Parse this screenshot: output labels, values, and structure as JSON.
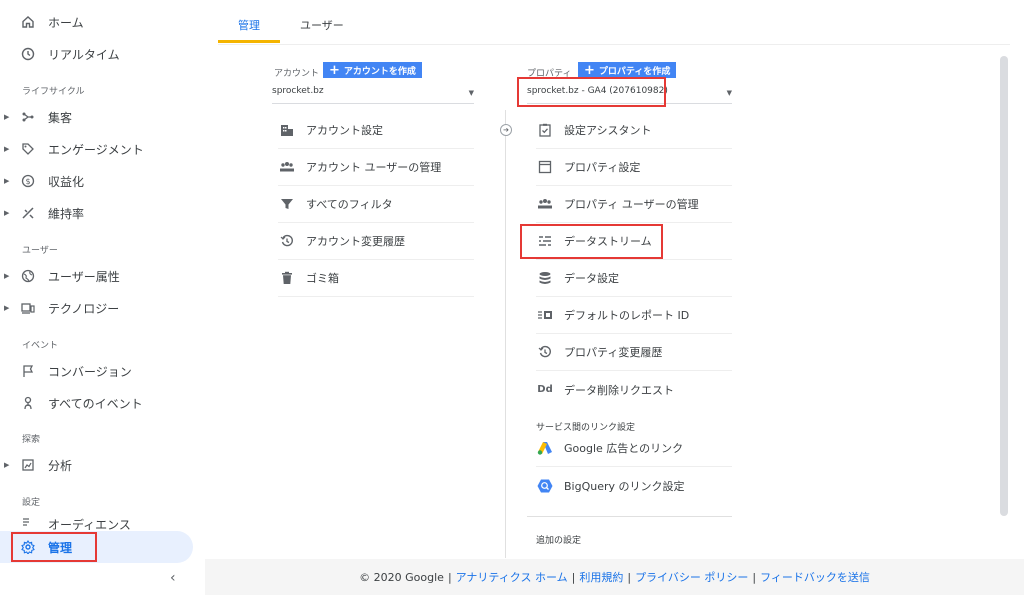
{
  "sidebar": {
    "nav": {
      "home": "ホーム",
      "realtime": "リアルタイム",
      "acquisition": "集客",
      "engagement": "エンゲージメント",
      "monetization": "収益化",
      "retention": "維持率",
      "demographics": "ユーザー属性",
      "tech": "テクノロジー",
      "conversions": "コンバージョン",
      "all_events": "すべてのイベント",
      "analysis": "分析",
      "audiences": "オーディエンス",
      "admin": "管理"
    },
    "sections": {
      "lifecycle": "ライフサイクル",
      "user": "ユーザー",
      "event": "イベント",
      "explore": "探索",
      "config": "設定"
    },
    "collapse": "‹"
  },
  "header": {
    "tabs": [
      "管理",
      "ユーザー"
    ]
  },
  "account": {
    "label": "アカウント",
    "create": "アカウントを作成",
    "selected": "sprocket.bz",
    "items": [
      "アカウント設定",
      "アカウント ユーザーの管理",
      "すべてのフィルタ",
      "アカウント変更履歴",
      "ゴミ箱"
    ]
  },
  "property": {
    "label": "プロパティ",
    "create": "プロパティを作成",
    "selected": "sprocket.bz - GA4 (207610982)",
    "items": [
      "設定アシスタント",
      "プロパティ設定",
      "プロパティ ユーザーの管理",
      "データストリーム",
      "データ設定",
      "デフォルトのレポート ID",
      "プロパティ変更履歴",
      "データ削除リクエスト"
    ],
    "links_heading": "サービス間のリンク設定",
    "links": [
      "Google 広告とのリンク",
      "BigQuery のリンク設定"
    ],
    "extra_heading": "追加の設定"
  },
  "footer": {
    "copyright": "© 2020 Google",
    "links": [
      "アナリティクス ホーム",
      "利用規約",
      "プライバシー ポリシー",
      "フィードバックを送信"
    ]
  },
  "colors": {
    "accent": "#1a73e8",
    "button": "#4285f4",
    "highlight": "#e53935",
    "tab_underline": "#f4b400"
  }
}
